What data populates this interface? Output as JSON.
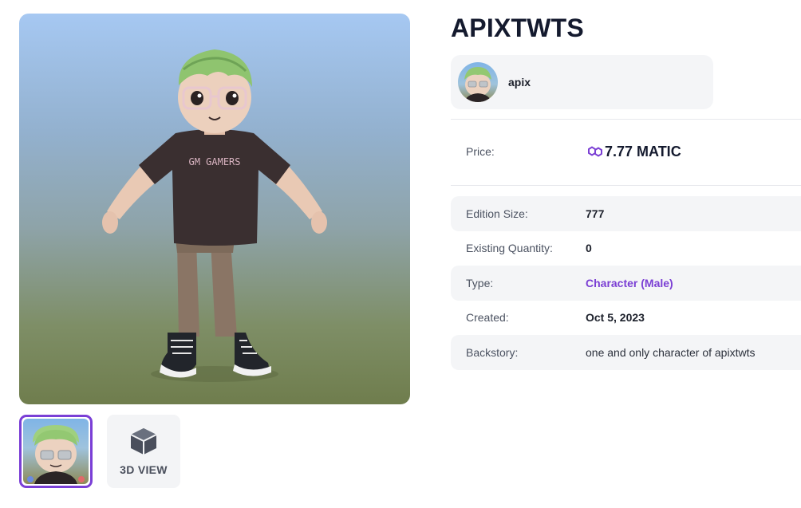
{
  "item": {
    "title": "APIXTWTS"
  },
  "owner": {
    "name": "apix"
  },
  "price": {
    "label": "Price:",
    "value": "7.77 MATIC",
    "currency_icon": "polygon-icon",
    "accent": "#7b3fd4"
  },
  "details": [
    {
      "label": "Edition Size:",
      "value": "777"
    },
    {
      "label": "Existing Quantity:",
      "value": "0"
    },
    {
      "label": "Type:",
      "value": "Character (Male)"
    },
    {
      "label": "Created:",
      "value": "Oct 5, 2023"
    },
    {
      "label": "Backstory:",
      "value": "one and only character of apixtwts"
    }
  ],
  "viewer": {
    "shirt_text": "GM GAMERS"
  },
  "thumbnails": {
    "avatar_selected_border": "#7a3fd6",
    "view3d_label": "3D VIEW",
    "view3d_icon": "cube-icon"
  }
}
